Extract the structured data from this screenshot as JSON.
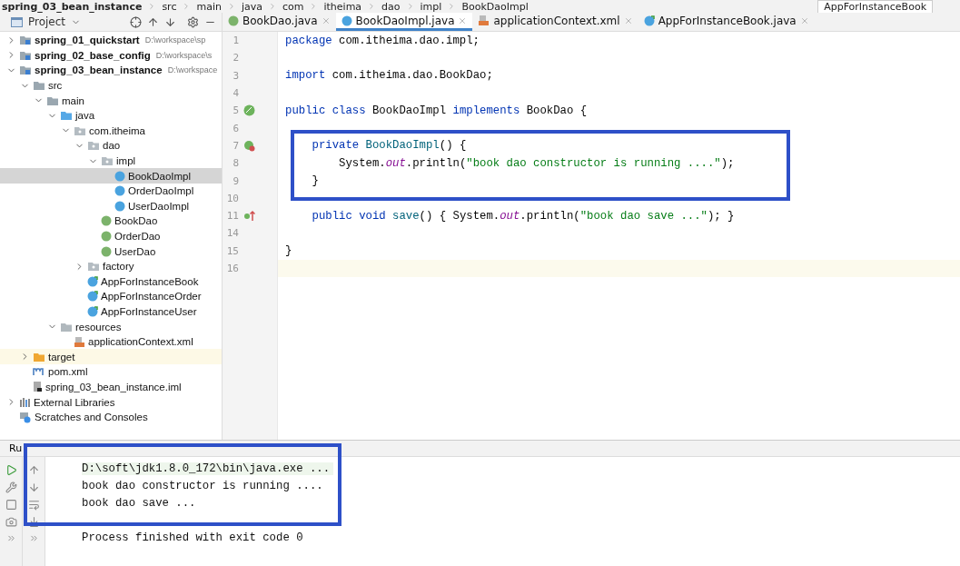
{
  "breadcrumb": [
    "spring_03_bean_instance",
    "src",
    "main",
    "java",
    "com",
    "itheima",
    "dao",
    "impl",
    "BookDaoImpl"
  ],
  "run_config": "AppForInstanceBook",
  "project_panel": {
    "title": "Project"
  },
  "tree": [
    {
      "label": "spring_01_quickstart",
      "hint": "D:\\workspace\\sp",
      "kind": "module",
      "expanded": false,
      "selected": false
    },
    {
      "label": "spring_02_base_config",
      "hint": "D:\\workspace\\s",
      "kind": "module",
      "expanded": false,
      "selected": false
    },
    {
      "label": "spring_03_bean_instance",
      "hint": "D:\\workspace",
      "kind": "module",
      "expanded": true,
      "selected": false,
      "children": [
        {
          "label": "src",
          "kind": "folder",
          "expanded": true,
          "selected": false,
          "children": [
            {
              "label": "main",
              "kind": "folder",
              "expanded": true,
              "selected": false,
              "children": [
                {
                  "label": "java",
                  "kind": "source-folder",
                  "expanded": true,
                  "selected": false,
                  "children": [
                    {
                      "label": "com.itheima",
                      "kind": "package",
                      "expanded": true,
                      "selected": false,
                      "children": [
                        {
                          "label": "dao",
                          "kind": "package",
                          "expanded": true,
                          "selected": false,
                          "children": [
                            {
                              "label": "impl",
                              "kind": "package",
                              "expanded": true,
                              "selected": false,
                              "children": [
                                {
                                  "label": "BookDaoImpl",
                                  "kind": "class",
                                  "selected": true
                                },
                                {
                                  "label": "OrderDaoImpl",
                                  "kind": "class",
                                  "selected": false
                                },
                                {
                                  "label": "UserDaoImpl",
                                  "kind": "class",
                                  "selected": false
                                }
                              ]
                            },
                            {
                              "label": "BookDao",
                              "kind": "interface",
                              "selected": false
                            },
                            {
                              "label": "OrderDao",
                              "kind": "interface",
                              "selected": false
                            },
                            {
                              "label": "UserDao",
                              "kind": "interface",
                              "selected": false
                            }
                          ]
                        },
                        {
                          "label": "factory",
                          "kind": "package",
                          "expanded": false,
                          "selected": false
                        },
                        {
                          "label": "AppForInstanceBook",
                          "kind": "main-class",
                          "selected": false
                        },
                        {
                          "label": "AppForInstanceOrder",
                          "kind": "main-class",
                          "selected": false
                        },
                        {
                          "label": "AppForInstanceUser",
                          "kind": "main-class",
                          "selected": false
                        }
                      ]
                    }
                  ]
                },
                {
                  "label": "resources",
                  "kind": "resources-folder",
                  "expanded": true,
                  "selected": false,
                  "children": [
                    {
                      "label": "applicationContext.xml",
                      "kind": "xml",
                      "selected": false
                    }
                  ]
                }
              ]
            }
          ]
        },
        {
          "label": "target",
          "kind": "excluded-folder",
          "expanded": false,
          "selected": false
        },
        {
          "label": "pom.xml",
          "kind": "maven",
          "selected": false
        },
        {
          "label": "spring_03_bean_instance.iml",
          "kind": "iml",
          "selected": false
        }
      ]
    },
    {
      "label": "External Libraries",
      "kind": "libraries",
      "expanded": false,
      "selected": false
    },
    {
      "label": "Scratches and Consoles",
      "kind": "scratches",
      "selected": false
    }
  ],
  "editor_tabs": [
    {
      "label": "BookDao.java",
      "kind": "interface",
      "selected": false
    },
    {
      "label": "BookDaoImpl.java",
      "kind": "class",
      "selected": true
    },
    {
      "label": "applicationContext.xml",
      "kind": "xml",
      "selected": false
    },
    {
      "label": "AppForInstanceBook.java",
      "kind": "main-class",
      "selected": false
    }
  ],
  "code_lines": [
    {
      "number": "1",
      "tokens": [
        {
          "kind": "keyword",
          "text": "package"
        },
        {
          "kind": "plain",
          "text": " com.itheima.dao.impl;"
        }
      ]
    },
    {
      "number": "2"
    },
    {
      "number": "3",
      "tokens": [
        {
          "kind": "keyword",
          "text": "import"
        },
        {
          "kind": "plain",
          "text": " com.itheima.dao.BookDao;"
        }
      ]
    },
    {
      "number": "4"
    },
    {
      "number": "5",
      "marker": {
        "kind": "implements"
      },
      "tokens": [
        {
          "kind": "keyword",
          "text": "public class"
        },
        {
          "kind": "plain",
          "text": " BookDaoImpl "
        },
        {
          "kind": "keyword",
          "text": "implements"
        },
        {
          "kind": "plain",
          "text": " BookDao {"
        }
      ]
    },
    {
      "number": "6"
    },
    {
      "number": "7",
      "marker": {
        "kind": "method"
      },
      "tokens": [
        {
          "kind": "keyword",
          "text": "    private "
        },
        {
          "kind": "declaration",
          "text": "BookDaoImpl"
        },
        {
          "kind": "plain",
          "text": "() {"
        }
      ]
    },
    {
      "number": "8",
      "tokens": [
        {
          "kind": "plain",
          "text": "        System."
        },
        {
          "kind": "field",
          "text": "out"
        },
        {
          "kind": "plain",
          "text": ".println("
        },
        {
          "kind": "string",
          "text": "\"book dao constructor is running ....\""
        },
        {
          "kind": "plain",
          "text": ");"
        }
      ]
    },
    {
      "number": "9",
      "tokens": [
        {
          "kind": "plain",
          "text": "    }"
        }
      ]
    },
    {
      "number": "10"
    },
    {
      "number": "11",
      "marker": {
        "kind": "override"
      },
      "tokens": [
        {
          "kind": "keyword",
          "text": "    public void "
        },
        {
          "kind": "declaration",
          "text": "save"
        },
        {
          "kind": "plain",
          "text": "() { System."
        },
        {
          "kind": "field",
          "text": "out"
        },
        {
          "kind": "plain",
          "text": ".println("
        },
        {
          "kind": "string",
          "text": "\"book dao save ...\""
        },
        {
          "kind": "plain",
          "text": "); }"
        }
      ]
    },
    {
      "number": "14"
    },
    {
      "number": "15",
      "tokens": [
        {
          "kind": "plain",
          "text": "}"
        }
      ]
    },
    {
      "number": "16",
      "current": true
    }
  ],
  "run_panel": {
    "label": "Ru"
  },
  "console_lines": [
    {
      "kind": "command",
      "text": "D:\\soft\\jdk1.8.0_172\\bin\\java.exe ..."
    },
    {
      "kind": "output",
      "text": "book dao constructor is running ...."
    },
    {
      "kind": "output",
      "text": "book dao save ..."
    },
    {
      "kind": "blank"
    },
    {
      "kind": "output",
      "text": "Process finished with exit code 0"
    }
  ]
}
